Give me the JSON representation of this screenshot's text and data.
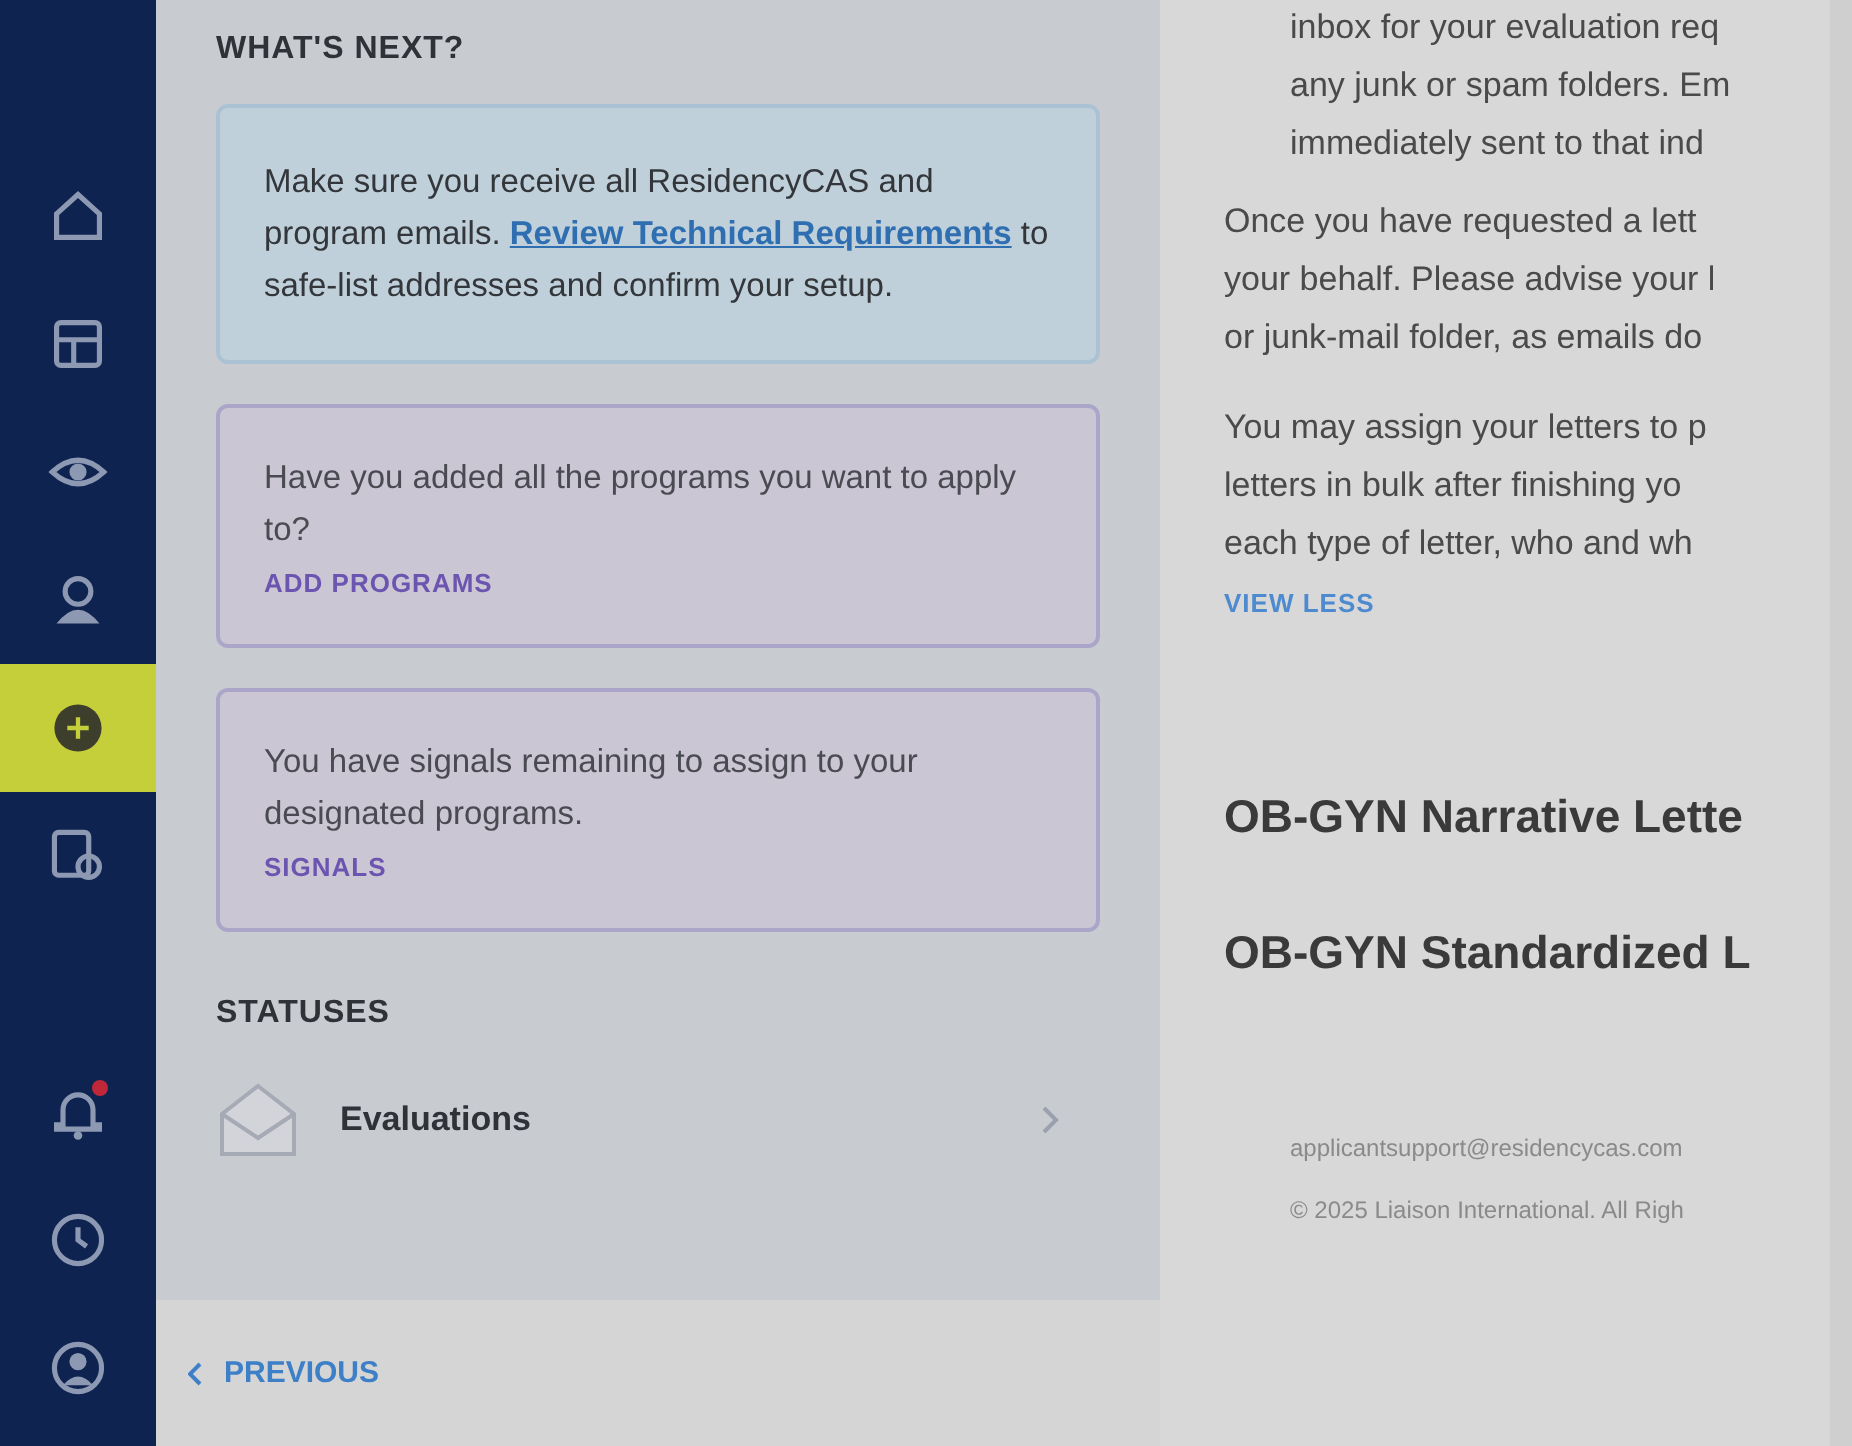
{
  "sidebar": {
    "items": [
      {
        "selected": false,
        "notification": false
      },
      {
        "selected": false,
        "notification": false
      },
      {
        "selected": false,
        "notification": false
      },
      {
        "selected": false,
        "notification": false
      },
      {
        "selected": true,
        "notification": false
      },
      {
        "selected": false,
        "notification": false
      },
      {
        "selected": false,
        "notification": true
      },
      {
        "selected": false,
        "notification": false
      },
      {
        "selected": false,
        "notification": false
      }
    ]
  },
  "whats_next": {
    "heading": "WHAT'S NEXT?",
    "cards": [
      {
        "kind": "info",
        "text": "Make sure you receive all ResidencyCAS and program emails. **Review Technical Requirements** to safe-list addresses and confirm your setup."
      },
      {
        "kind": "task",
        "text": "Have you added all the programs you want to apply to?",
        "action": "ADD PROGRAMS"
      },
      {
        "kind": "task",
        "text": "You have signals remaining to assign to your designated programs.",
        "action": "SIGNALS"
      }
    ]
  },
  "statuses": {
    "heading": "STATUSES",
    "items": [
      {
        "label": "Evaluations"
      }
    ]
  },
  "footer_nav": {
    "previous": "PREVIOUS"
  },
  "content": {
    "paragraphs": [
      {
        "kind": "indented",
        "lines": [
          "inbox for your evaluation req",
          "any junk or spam folders. Em",
          "immediately sent to that ind"
        ]
      },
      {
        "kind": "plain",
        "lines": [
          "Once you have requested a lett",
          "your behalf. Please advise your l",
          "or junk-mail folder, as emails do"
        ]
      },
      {
        "kind": "plain",
        "lines": [
          "You may assign your letters to p",
          "letters in bulk after finishing yo",
          "each type of letter, who and wh"
        ]
      }
    ],
    "toggle": "VIEW LESS",
    "letters": [
      "OB-GYN Narrative Lette",
      "OB-GYN Standardized L"
    ],
    "email": "applicantsupport@residencycas.com",
    "copyright": "© 2025 Liaison International. All Righ"
  }
}
